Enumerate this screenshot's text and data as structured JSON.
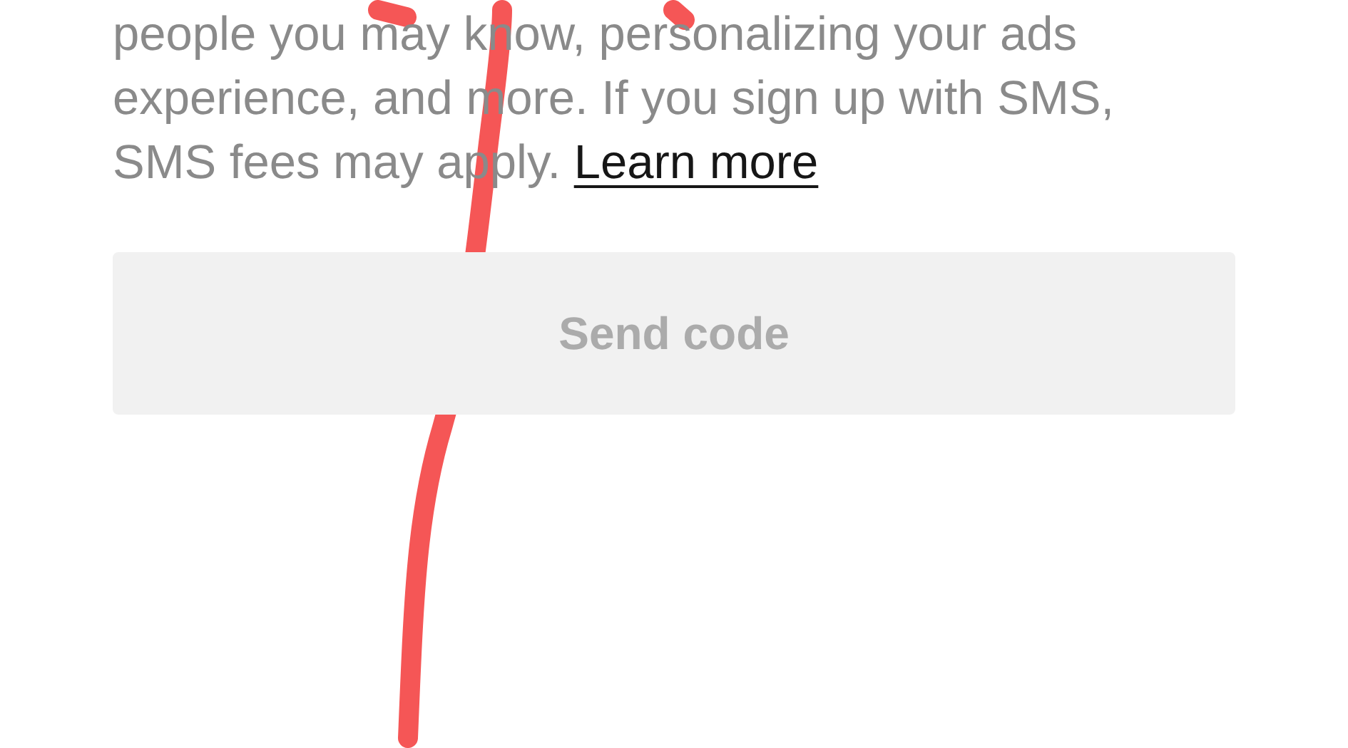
{
  "disclaimer": {
    "text": "people you may know, personalizing your ads experience, and more. If you sign up with SMS, SMS fees may apply.",
    "link": "Learn more"
  },
  "send_button": {
    "label": "Send code",
    "disabled": true
  }
}
